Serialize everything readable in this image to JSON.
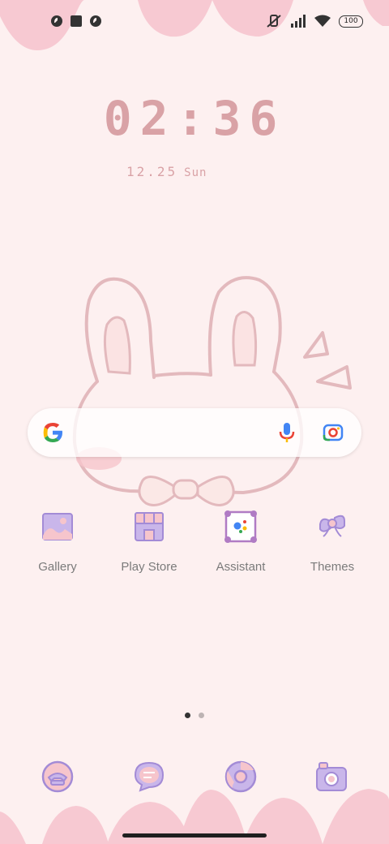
{
  "status_bar": {
    "battery": "100",
    "left_icons": [
      "notification-icon-1",
      "notification-icon-square",
      "notification-icon-2"
    ],
    "right_icons": [
      "mute-icon",
      "signal-icon",
      "wifi-icon",
      "battery-icon"
    ]
  },
  "clock": {
    "time": "02:36",
    "date": "12.25",
    "weekday": "Sun"
  },
  "search": {
    "icons": [
      "google-icon",
      "mic-icon",
      "lens-icon"
    ]
  },
  "apps": [
    {
      "label": "Gallery",
      "icon": "gallery-icon"
    },
    {
      "label": "Play Store",
      "icon": "play-store-icon"
    },
    {
      "label": "Assistant",
      "icon": "assistant-icon"
    },
    {
      "label": "Themes",
      "icon": "themes-icon"
    }
  ],
  "dock": [
    {
      "icon": "phone-icon"
    },
    {
      "icon": "messages-icon"
    },
    {
      "icon": "chrome-icon"
    },
    {
      "icon": "camera-icon"
    }
  ],
  "page_indicator": {
    "pages": 2,
    "current": 1
  },
  "colors": {
    "background": "#fdf0f0",
    "accent_pink": "#f7c9d2",
    "clock_pink": "#d9a2a6",
    "icon_purple": "#b7a3de"
  }
}
